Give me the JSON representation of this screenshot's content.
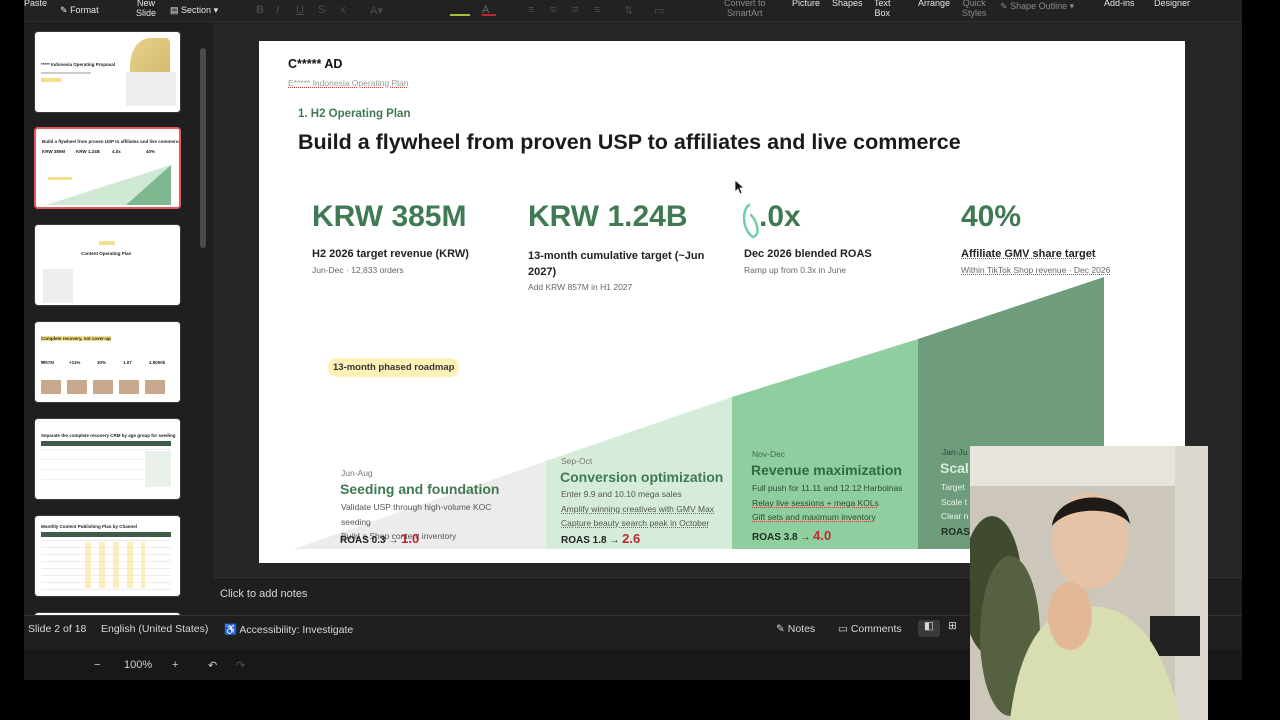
{
  "ribbon": {
    "paste": "Paste",
    "format": "Format",
    "new_slide": [
      "New",
      "Slide"
    ],
    "section": "Section",
    "convert_smartart": [
      "Convert to",
      "SmartArt"
    ],
    "picture": "Picture",
    "shapes": "Shapes",
    "text_box": [
      "Text",
      "Box"
    ],
    "arrange": "Arrange",
    "quick_styles": [
      "Quick",
      "Styles"
    ],
    "shape_outline": "Shape Outline",
    "add_ins": "Add-ins",
    "designer": "Designer"
  },
  "thumbnails": [
    {
      "title": "***** Indonesia Operating Proposal"
    },
    {
      "title": "Build a flywheel from proven USP to affiliates and live commerce",
      "stats": [
        "KRW 385M",
        "KRW 1.24B",
        "4.0x",
        "40%"
      ]
    },
    {
      "title": "Content Operating Plan"
    },
    {
      "title": "Complete recovery, not cover-up",
      "stats": [
        "₩57M",
        "+11%",
        "30%",
        "1.07",
        "1.5000k"
      ]
    },
    {
      "title": "Separate the complete recovery CRM by age group for seeding"
    },
    {
      "title": "Monthly Content Publishing Plan by Channel"
    }
  ],
  "slide": {
    "brand": "C***** AD",
    "subtitle": "E***** Indonesia Operating Plan",
    "section": "1. H2 Operating Plan",
    "headline": "Build a flywheel from proven USP to affiliates and live commerce",
    "kpis": [
      {
        "value": "KRW 385M",
        "label": "H2 2026 target revenue (KRW)",
        "sub": "Jun-Dec · 12,833 orders"
      },
      {
        "value": "KRW 1.24B",
        "label": "13-month cumulative target (~Jun 2027)",
        "sub": "Add KRW 857M in H1 2027"
      },
      {
        "value": ".0x",
        "label": "Dec 2026 blended ROAS",
        "sub": "Ramp up from 0.3x in June"
      },
      {
        "value": "40%",
        "label": "Affiliate GMV share target",
        "sub": "Within TikTok Shop revenue · Dec 2026"
      }
    ],
    "roadmap_tag": "13-month phased roadmap",
    "phases": [
      {
        "period": "Jun-Aug",
        "title": "Seeding and foundation",
        "lines": [
          "Validate USP through high-volume KOC",
          "seeding",
          "Build a Shop content inventory"
        ],
        "roas_prefix": "ROAS 0.3 →",
        "roas_target": "1.0",
        "color": "#eaeaea"
      },
      {
        "period": "Sep-Oct",
        "title": "Conversion optimization",
        "lines": [
          "Enter 9.9 and 10.10 mega sales",
          "Amplify winning creatives with GMV Max",
          "Capture beauty search peak in October"
        ],
        "roas_prefix": "ROAS 1.8 →",
        "roas_target": "2.6",
        "color": "#d4ecd9"
      },
      {
        "period": "Nov-Dec",
        "title": "Revenue maximization",
        "lines": [
          "Full push for 11.11 and 12.12 Harbolnas",
          "Relay live sessions + mega KOLs",
          "Gift sets and maximum inventory"
        ],
        "roas_prefix": "ROAS 3.8 →",
        "roas_target": "4.0",
        "color": "#8fcf9f"
      },
      {
        "period": "Jan-Ju",
        "title": "Scal",
        "lines": [
          "Target",
          "Scale t",
          "Clear n"
        ],
        "roas_prefix": "ROAS",
        "roas_target": "",
        "color": "#6f9d7c"
      }
    ]
  },
  "notes_placeholder": "Click to add notes",
  "status": {
    "slide_counter": "Slide 2 of 18",
    "language": "English (United States)",
    "accessibility": "Accessibility: Investigate",
    "notes": "Notes",
    "comments": "Comments"
  },
  "zoom": {
    "level": "100%"
  },
  "colors": {
    "accent_red": "#c0262d",
    "brand_green": "#3f7a52",
    "selection": "#e35b5b"
  }
}
